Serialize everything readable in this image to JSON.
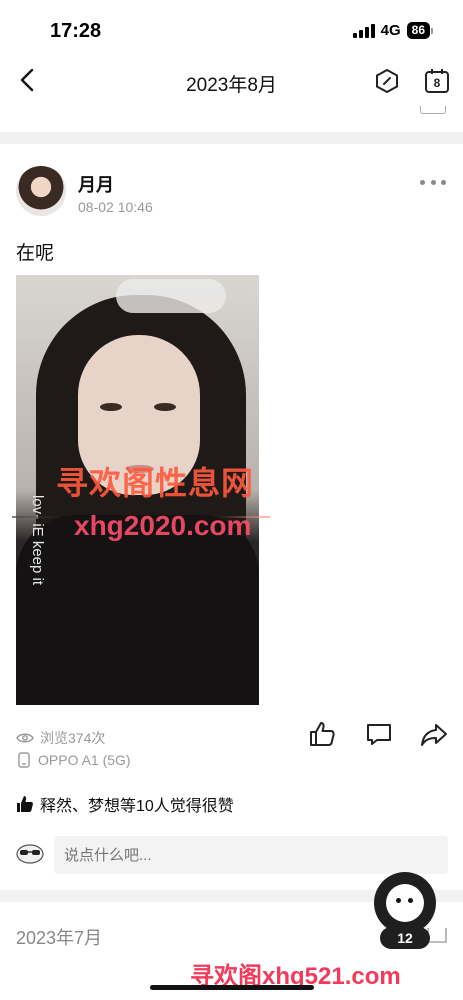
{
  "status_bar": {
    "time": "17:28",
    "network": "4G",
    "battery": "86"
  },
  "nav": {
    "title": "2023年8月",
    "calendar_day": "8"
  },
  "post": {
    "author": "月月",
    "time": "08-02 10:46",
    "text": "在呢",
    "photo_shirt_text": "lov- iE keep it",
    "views": "浏览374次",
    "device": "OPPO A1 (5G)",
    "likes": "释然、梦想等10人觉得很赞",
    "comment_placeholder": "说点什么吧..."
  },
  "next_month": "2023年7月",
  "floating_badge": "12",
  "watermarks": {
    "photo_cn": "寻欢阁性息网",
    "photo_url": "xhg2020.com",
    "bottom": "寻欢阁xhg521.com"
  },
  "colors": {
    "accent_watermark": "#ff5a3c",
    "divider": "#f1f1f1",
    "muted": "#999999"
  },
  "icons": [
    "back-icon",
    "hexagon-icon",
    "calendar-icon",
    "more-icon",
    "eye-icon",
    "phone-icon",
    "like-icon",
    "comment-icon",
    "share-icon",
    "thumb-icon"
  ]
}
